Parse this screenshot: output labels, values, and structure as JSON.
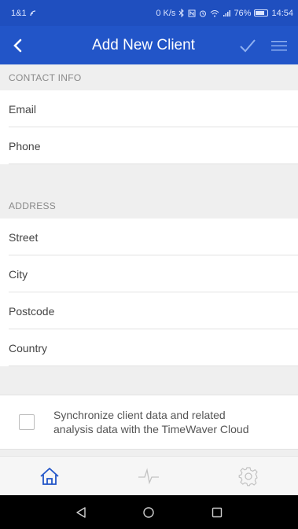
{
  "status_bar": {
    "carrier": "1&1",
    "speed": "0 K/s",
    "signal": "76%",
    "time": "14:54"
  },
  "app_bar": {
    "title": "Add New Client"
  },
  "sections": [
    {
      "header": "CONTACT INFO",
      "fields": [
        {
          "placeholder": "Email"
        },
        {
          "placeholder": "Phone"
        }
      ]
    },
    {
      "header": "ADDRESS",
      "fields": [
        {
          "placeholder": "Street"
        },
        {
          "placeholder": "City"
        },
        {
          "placeholder": "Postcode"
        },
        {
          "placeholder": "Country"
        }
      ]
    }
  ],
  "sync": {
    "label_line1": "Synchronize client data and related",
    "label_line2": "analysis data with the TimeWaver Cloud",
    "checked": false
  },
  "tabs": [
    {
      "icon": "home-icon",
      "active": true
    },
    {
      "icon": "pulse-icon",
      "active": false
    },
    {
      "icon": "gear-icon",
      "active": false
    }
  ],
  "colors": {
    "appbar": "#2255c8",
    "statusbar": "#1f4fbf",
    "active_tab": "#2255c8",
    "inactive_tab": "#bdbdbd"
  }
}
